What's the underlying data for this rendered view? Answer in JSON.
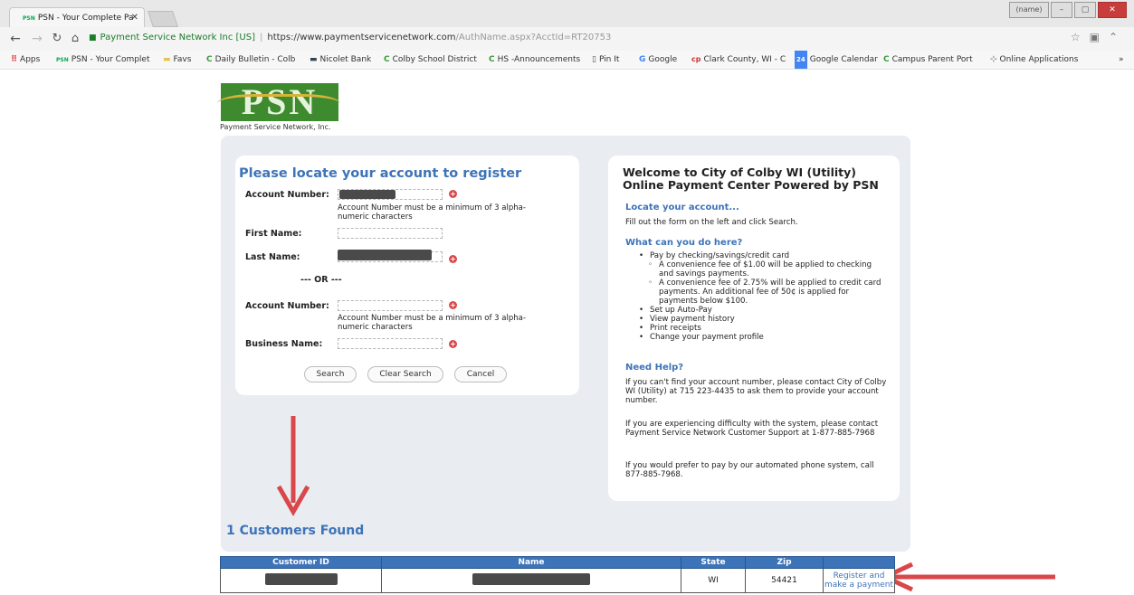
{
  "browser": {
    "tab_title": "PSN - Your Complete Pa",
    "tab_favicon": "PSN",
    "tab_close": "✕",
    "window_user": "(name)",
    "secure_label": "Payment Service Network Inc [US]",
    "url_host": "https://www.paymentservicenetwork.com",
    "url_path": "/AuthName.aspx?AcctId=RT20753",
    "bookmarks": [
      {
        "icon": "⠿",
        "label": "Apps"
      },
      {
        "icon": "PSN",
        "label": "PSN - Your Complet"
      },
      {
        "icon": "▬",
        "label": "Favs"
      },
      {
        "icon": "C",
        "label": "Daily Bulletin - Colb"
      },
      {
        "icon": "▬",
        "label": "Nicolet Bank"
      },
      {
        "icon": "C",
        "label": "Colby School District"
      },
      {
        "icon": "C",
        "label": "HS -Announcements"
      },
      {
        "icon": "▯",
        "label": "Pin It"
      },
      {
        "icon": "G",
        "label": "Google"
      },
      {
        "icon": "cp",
        "label": "Clark County, WI - C"
      },
      {
        "icon": "24",
        "label": "Google Calendar"
      },
      {
        "icon": "C",
        "label": "Campus Parent Port"
      },
      {
        "icon": "⊹",
        "label": "Online Applications"
      }
    ],
    "more_bookmarks": "»"
  },
  "logo": {
    "text": "PSN",
    "tagline": "Payment Service Network, Inc."
  },
  "form": {
    "title": "Please locate your account to register",
    "account_number_label": "Account Number:",
    "account_hint": "Account Number must be a minimum of 3 alpha-numeric characters",
    "first_name_label": "First Name:",
    "last_name_label": "Last Name:",
    "or_text": "--- OR ---",
    "account_number2_label": "Account Number:",
    "account_hint2": "Account Number must be a minimum of 3 alpha-numeric characters",
    "business_name_label": "Business Name:",
    "search_button": "Search",
    "clear_button": "Clear Search",
    "cancel_button": "Cancel"
  },
  "info": {
    "title": "Welcome to City of Colby WI (Utility) Online Payment Center Powered by PSN",
    "locate_heading": "Locate your account...",
    "locate_text": "Fill out the form on the left and click Search.",
    "can_do_heading": "What can you do here?",
    "items": [
      {
        "text": "Pay by checking/savings/credit card",
        "sub": false
      },
      {
        "text": "A convenience fee of $1.00 will be applied to checking and savings payments.",
        "sub": true
      },
      {
        "text": "A convenience fee of 2.75% will be applied to credit card payments. An additional fee of 50¢ is applied for payments below $100.",
        "sub": true
      },
      {
        "text": "Set up Auto-Pay",
        "sub": false
      },
      {
        "text": "View payment history",
        "sub": false
      },
      {
        "text": "Print receipts",
        "sub": false
      },
      {
        "text": "Change your payment profile",
        "sub": false
      }
    ],
    "help_heading": "Need Help?",
    "help_text1": "If you can't find your account number, please contact City of Colby WI (Utility) at 715 223-4435 to ask them to provide your account number.",
    "help_text2": "If you are experiencing difficulty with the system, please contact Payment Service Network Customer Support at 1-877-885-7968",
    "help_text3": "If you would prefer to pay by our automated phone system, call 877-885-7968."
  },
  "results": {
    "found_text": "1 Customers Found",
    "columns": [
      "Customer ID",
      "Name",
      "State",
      "Zip"
    ],
    "rows": [
      {
        "state": "WI",
        "zip": "54421",
        "action": "Register and make a payment"
      }
    ]
  },
  "colors": {
    "accent_blue": "#3d73b8",
    "annotation_red": "#d9474a",
    "logo_green": "#3d8b2e"
  }
}
